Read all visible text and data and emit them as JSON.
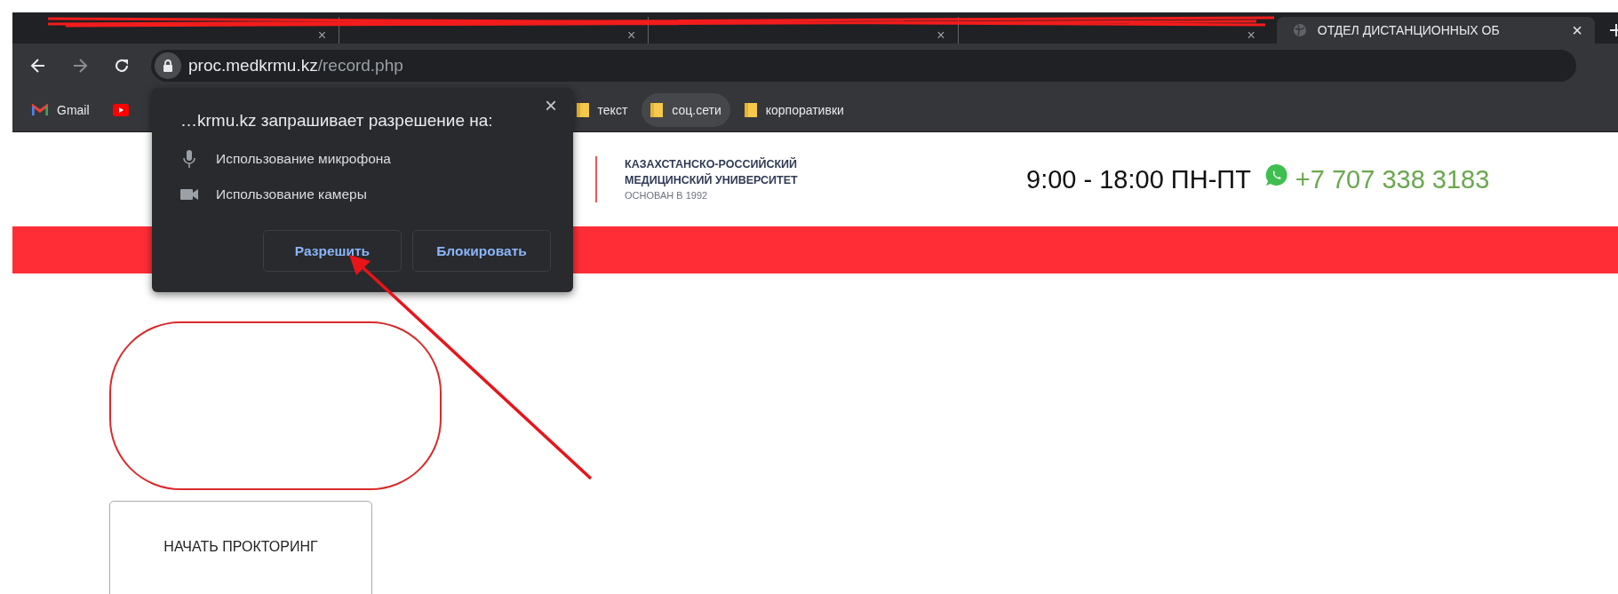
{
  "browser": {
    "tabs": [
      {
        "kind": "redacted",
        "close": "×",
        "selected": false
      },
      {
        "kind": "redacted",
        "close": "×",
        "selected": false
      },
      {
        "kind": "redacted",
        "close": "×",
        "selected": false
      },
      {
        "kind": "redacted",
        "close": "×",
        "selected": false
      },
      {
        "kind": "page",
        "title": "ОТДЕЛ ДИСТАНЦИОННЫХ ОБ",
        "close": "×",
        "selected": true
      }
    ],
    "address": {
      "host": "proc.medkrmu.kz",
      "path": "/record.php"
    },
    "bookmarks": [
      {
        "kind": "gmail",
        "label": "Gmail",
        "hovered": false
      },
      {
        "kind": "youtube",
        "hovered": false
      },
      {
        "kind": "folder",
        "label": "текст",
        "hovered": false
      },
      {
        "kind": "folder",
        "label": "соц.сети",
        "hovered": true
      },
      {
        "kind": "folder",
        "label": "корпоративки",
        "hovered": false
      }
    ]
  },
  "permission_popup": {
    "title": "…krmu.kz запрашивает разрешение на:",
    "close": "×",
    "permissions": [
      {
        "kind": "microphone",
        "label": "Использование микрофона"
      },
      {
        "kind": "camera",
        "label": "Использование камеры"
      }
    ],
    "buttons": [
      "Разрешить",
      "Блокировать"
    ]
  },
  "header": {
    "logo_lines": [
      "КАЗАХСТАНСКО-РОССИЙСКИЙ",
      "МЕДИЦИНСКИЙ УНИВЕРСИТЕТ"
    ],
    "logo_sub": "ОСНОВАН В 1992",
    "hours": "9:00 - 18:00 ПН-ПТ",
    "phone": "+7 707 338 3183"
  },
  "content": {
    "start_button": "НАЧАТЬ ПРОКТОРИНГ"
  }
}
